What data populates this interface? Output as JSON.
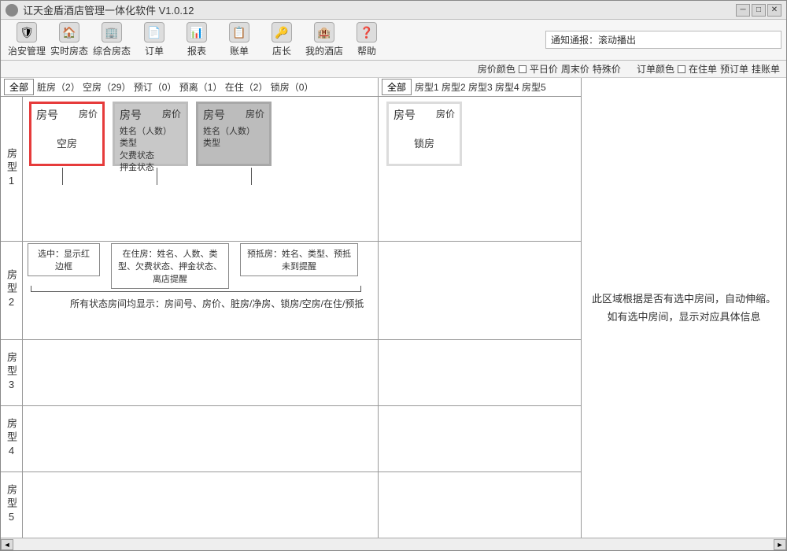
{
  "window": {
    "title": "讧天金盾酒店管理一体化软件  V1.0.12"
  },
  "toolbar": [
    {
      "label": "治安管理",
      "icon": "🛡"
    },
    {
      "label": "实时房态",
      "icon": "🏠"
    },
    {
      "label": "综合房态",
      "icon": "🏢"
    },
    {
      "label": "订单",
      "icon": "📄"
    },
    {
      "label": "报表",
      "icon": "📊"
    },
    {
      "label": "账单",
      "icon": "📋"
    },
    {
      "label": "店长",
      "icon": "🔑"
    },
    {
      "label": "我的酒店",
      "icon": "🏨"
    },
    {
      "label": "帮助",
      "icon": "❓"
    }
  ],
  "notice": {
    "prefix": "通知通报：",
    "text": "滚动播出"
  },
  "legend": {
    "price_colors": {
      "title": "房价颜色",
      "items": [
        "平日价",
        "周末价",
        "特殊价"
      ]
    },
    "order_colors": {
      "title": "订单颜色",
      "items": [
        "在住单",
        "预订单",
        "挂账单"
      ]
    }
  },
  "left_tabs": {
    "all": "全部",
    "items": [
      {
        "label": "脏房",
        "count": 2
      },
      {
        "label": "空房",
        "count": 29
      },
      {
        "label": "预订",
        "count": 0
      },
      {
        "label": "预离",
        "count": 1
      },
      {
        "label": "在住",
        "count": 2
      },
      {
        "label": "锁房",
        "count": 0
      }
    ]
  },
  "mid_tabs": {
    "all": "全部",
    "items": [
      "房型1",
      "房型2",
      "房型3",
      "房型4",
      "房型5"
    ]
  },
  "room_type_rows": [
    "房型1",
    "房型2",
    "房型3",
    "房型4",
    "房型5"
  ],
  "cards": {
    "c1": {
      "num": "房号",
      "price": "房价",
      "body": "空房"
    },
    "c2": {
      "num": "房号",
      "price": "房价",
      "body": "姓名（人数）  类型\n                欠费状态\n                押金状态"
    },
    "c3": {
      "num": "房号",
      "price": "房价",
      "body": "姓名（人数）  类型"
    },
    "c4": {
      "num": "房号",
      "price": "房价",
      "body": "锁房"
    }
  },
  "annotations": {
    "a1": "选中：显示红边框",
    "a2": "在住房：姓名、人数、类型、欠费状态、押金状态、离店提醒",
    "a3": "预抵房：姓名、类型、预抵未到提醒",
    "summary": "所有状态房间均显示：房间号、房价、脏房/净房、锁房/空房/在住/预抵"
  },
  "right_text": {
    "l1": "此区域根据是否有选中房间，自动伸缩。",
    "l2": "如有选中房间，显示对应具体信息"
  }
}
